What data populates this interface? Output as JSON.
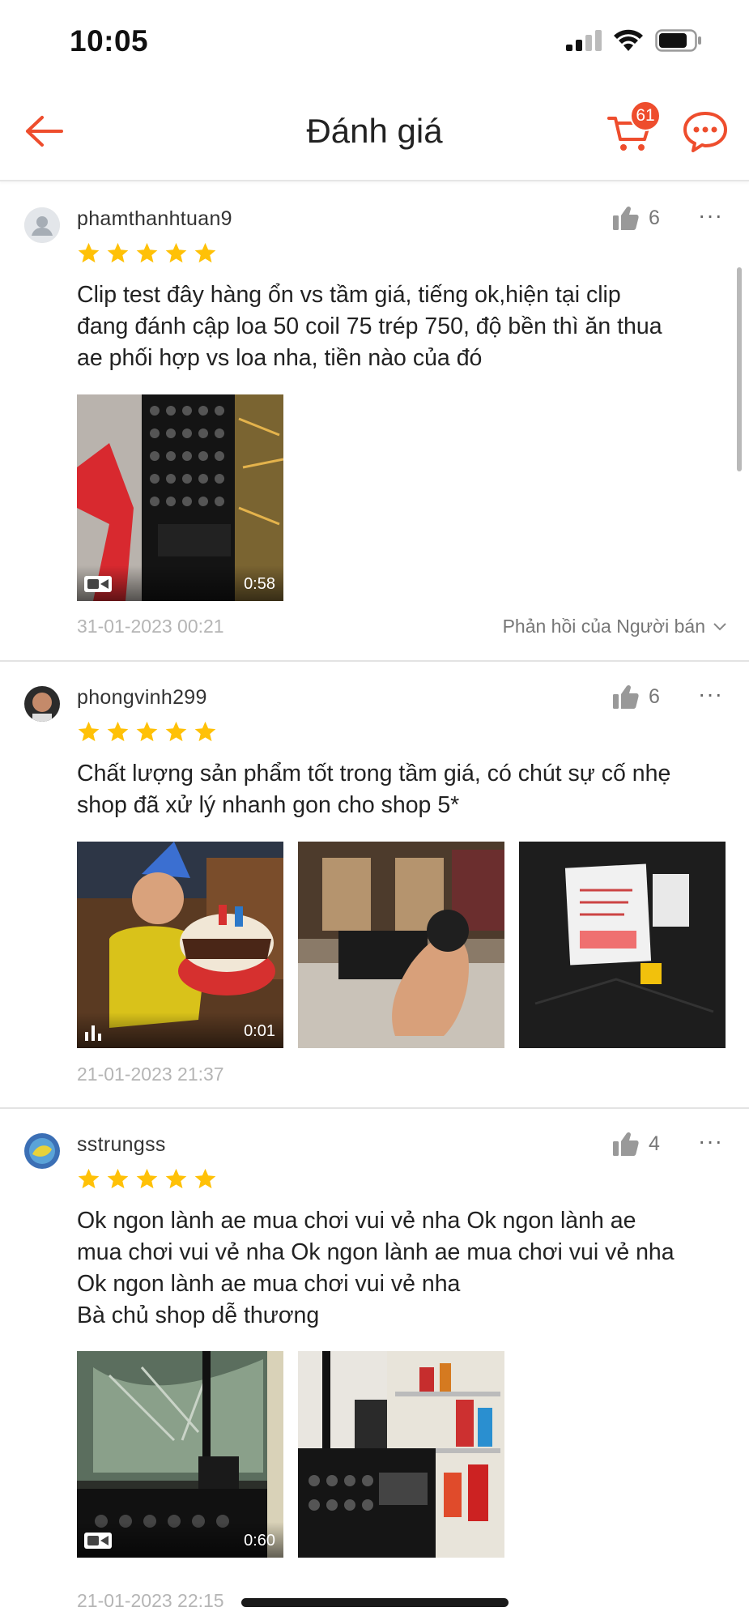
{
  "status_bar": {
    "time": "10:05"
  },
  "nav": {
    "title": "Đánh giá",
    "cart_count": "61"
  },
  "reviews": [
    {
      "username": "phamthanhtuan9",
      "likes": "6",
      "rating": 5,
      "text": "Clip test đây hàng ổn vs tầm giá, tiếng ok,hiện tại clip\nđang đánh cập loa 50 coil 75 trép 750, độ bền thì ăn thua\nae phối hợp vs loa nha, tiền nào của đó",
      "video_duration": "0:58",
      "date": "31-01-2023 00:21",
      "seller_reply": "Phản hồi của Người bán"
    },
    {
      "username": "phongvinh299",
      "likes": "6",
      "rating": 5,
      "text": "Chất lượng sản phẩm tốt trong tầm giá, có chút sự cố nhẹ\nshop đã xử lý nhanh gon cho shop 5*",
      "video_duration": "0:01",
      "date": "21-01-2023 21:37"
    },
    {
      "username": "sstrungss",
      "likes": "4",
      "rating": 5,
      "text": "Ok ngon lành ae mua chơi vui vẻ nha Ok ngon lành ae\nmua chơi vui vẻ nha Ok ngon lành ae mua chơi vui vẻ nha\nOk ngon lành ae mua chơi vui vẻ nha\nBà chủ shop dễ thương",
      "video_duration": "0:60",
      "date": "21-01-2023 22:15"
    }
  ],
  "colors": {
    "accent": "#ee4d2d",
    "star": "#ffc107"
  }
}
